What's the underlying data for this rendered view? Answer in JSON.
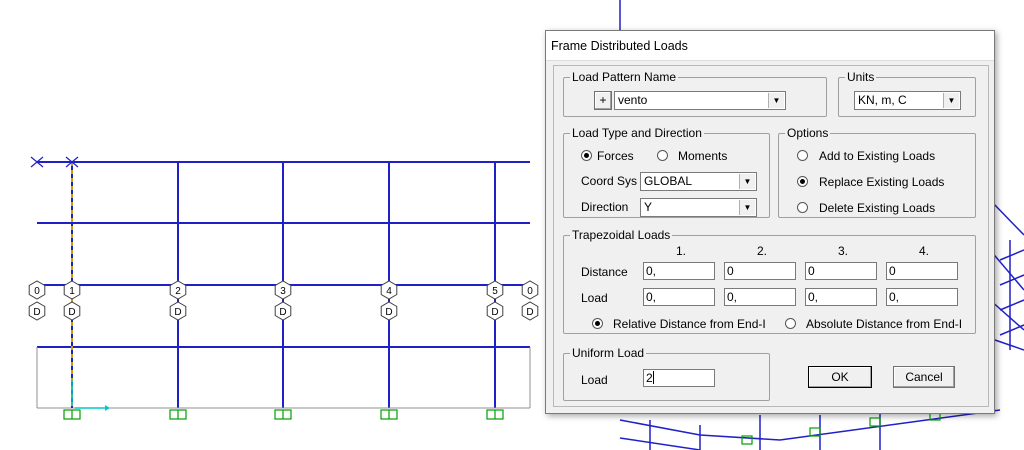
{
  "dialog": {
    "title": "Frame Distributed Loads",
    "load_pattern": {
      "group_label": "Load Pattern Name",
      "add_button": "+",
      "value": "vento"
    },
    "units": {
      "group_label": "Units",
      "value": "KN, m, C"
    },
    "load_type": {
      "group_label": "Load Type and Direction",
      "forces_label": "Forces",
      "moments_label": "Moments",
      "selected": "Forces",
      "coord_sys_label": "Coord Sys",
      "coord_sys_value": "GLOBAL",
      "direction_label": "Direction",
      "direction_value": "Y"
    },
    "options": {
      "group_label": "Options",
      "items": [
        "Add to Existing Loads",
        "Replace Existing Loads",
        "Delete Existing Loads"
      ],
      "selected_index": 1
    },
    "trapezoidal": {
      "group_label": "Trapezoidal Loads",
      "columns": [
        "1.",
        "2.",
        "3.",
        "4."
      ],
      "distance_label": "Distance",
      "distance_values": [
        "0,",
        "0",
        "0",
        "0"
      ],
      "load_label": "Load",
      "load_values": [
        "0,",
        "0,",
        "0,",
        "0,"
      ],
      "relative_label": "Relative Distance from End-I",
      "absolute_label": "Absolute Distance from End-I",
      "selected": "relative"
    },
    "uniform": {
      "group_label": "Uniform Load",
      "load_label": "Load",
      "load_value": "2"
    },
    "ok_label": "OK",
    "cancel_label": "Cancel"
  },
  "model_view": {
    "frame_color": "#2020c8",
    "support_color": "#00a000",
    "selected_member_color": "#c8a000",
    "bubble_top_labels": [
      "0",
      "1",
      "2",
      "3",
      "4",
      "5",
      "0"
    ],
    "bubble_bottom_labels": [
      "D",
      "D",
      "D",
      "D",
      "D",
      "D",
      "D"
    ]
  }
}
